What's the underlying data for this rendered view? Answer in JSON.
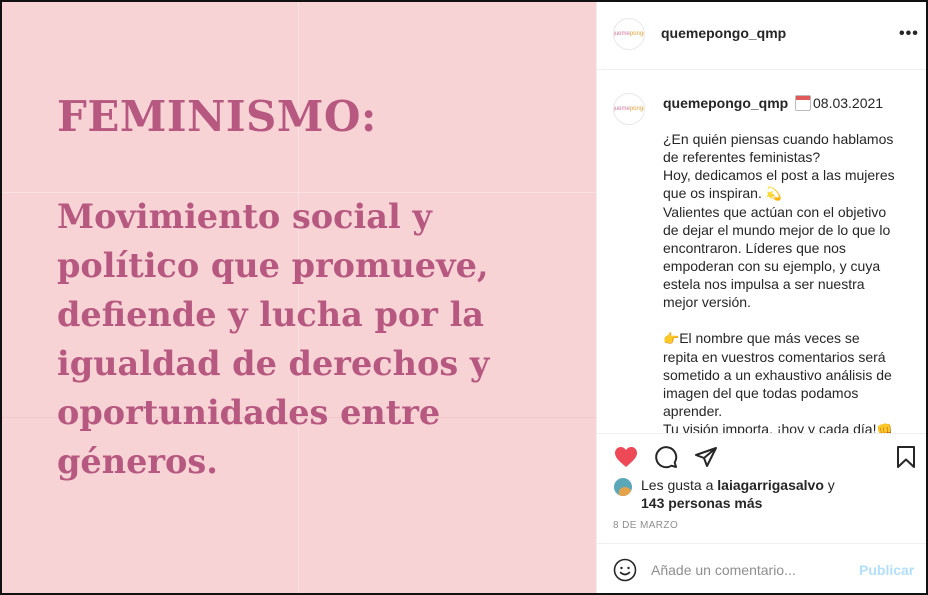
{
  "image": {
    "title": "FEMINISMO:",
    "body_lines": [
      "Movimiento social y",
      "político que promueve,",
      "defiende y lucha por la",
      "igualdad de derechos y",
      "oportunidades entre",
      "géneros."
    ]
  },
  "header": {
    "avatar_text_a": "queme",
    "avatar_text_b": "pongo",
    "username": "quemepongo_qmp",
    "more_label": "•••"
  },
  "caption": {
    "username": "quemepongo_qmp",
    "date": "08.03.2021",
    "lines": [
      "¿En quién piensas cuando hablamos",
      "de referentes feministas?",
      "Hoy, dedicamos el post a las mujeres",
      "que os inspiran.",
      "Valientes que actúan con el objetivo",
      "de dejar el mundo mejor de lo que lo",
      "encontraron. Líderes que nos",
      "empoderan con su ejemplo, y cuya",
      "estela nos impulsa a ser nuestra",
      "mejor versión.",
      "",
      "El nombre que más veces se",
      "repita en vuestros comentarios será",
      "sometido a un exhaustivo análisis de",
      "imagen del que todas podamos",
      "aprender.",
      "Tu visión importa, ¡hoy y cada día!"
    ],
    "emoji_sparkle": "💫",
    "emoji_hand": "👉",
    "emoji_fist": "👊"
  },
  "likes": {
    "prefix": "Les gusta a ",
    "user": "laiagarrigasalvo",
    "suffix": " y",
    "others": "143 personas más"
  },
  "post_date": "8 DE MARZO",
  "comment": {
    "placeholder": "Añade un comentario...",
    "publish_label": "Publicar"
  },
  "colors": {
    "image_bg": "#f8d3d5",
    "image_text": "#b6587f",
    "like_red": "#ed4956",
    "publish_disabled": "#b2dffc"
  }
}
